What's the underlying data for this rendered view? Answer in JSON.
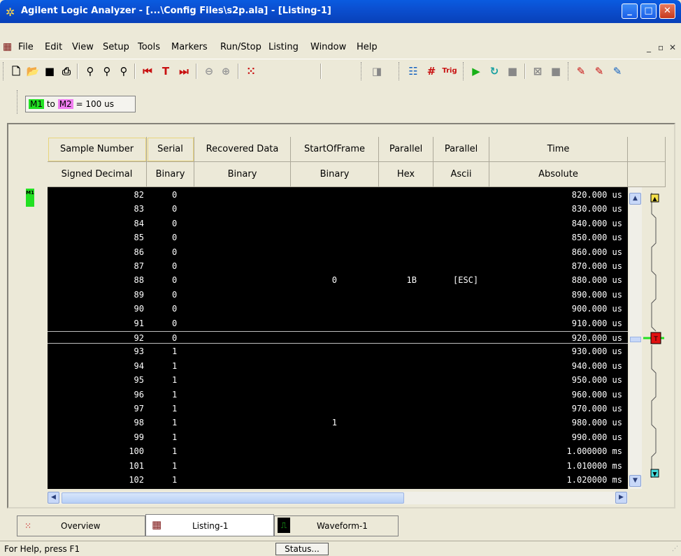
{
  "window": {
    "title": "Agilent Logic Analyzer - [...\\Config Files\\s2p.ala] - [Listing-1]"
  },
  "menu": [
    "File",
    "Edit",
    "View",
    "Setup",
    "Tools",
    "Markers",
    "Run/Stop",
    "Listing",
    "Window",
    "Help"
  ],
  "markers": {
    "m1": "M1",
    "to": "to",
    "m2": "M2",
    "interval": "= 100 us"
  },
  "columns": [
    {
      "name": "Sample Number",
      "format": "Signed Decimal"
    },
    {
      "name": "Serial",
      "format": "Binary"
    },
    {
      "name": "Recovered Data",
      "format": "Binary"
    },
    {
      "name": "StartOfFrame",
      "format": "Binary"
    },
    {
      "name": "Parallel",
      "format": "Hex"
    },
    {
      "name": "Parallel",
      "format": "Ascii"
    },
    {
      "name": "Time",
      "format": "Absolute"
    }
  ],
  "rows": [
    {
      "sample": "82",
      "serial": "0",
      "rec": "",
      "par": "",
      "asc": "",
      "time": "820.000 us"
    },
    {
      "sample": "83",
      "serial": "0",
      "rec": "",
      "par": "",
      "asc": "",
      "time": "830.000 us"
    },
    {
      "sample": "84",
      "serial": "0",
      "rec": "",
      "par": "",
      "asc": "",
      "time": "840.000 us"
    },
    {
      "sample": "85",
      "serial": "0",
      "rec": "",
      "par": "",
      "asc": "",
      "time": "850.000 us"
    },
    {
      "sample": "86",
      "serial": "0",
      "rec": "",
      "par": "",
      "asc": "",
      "time": "860.000 us"
    },
    {
      "sample": "87",
      "serial": "0",
      "rec": "",
      "par": "",
      "asc": "",
      "time": "870.000 us"
    },
    {
      "sample": "88",
      "serial": "0",
      "rec": "0",
      "par": "1B",
      "asc": "[ESC]",
      "time": "880.000 us"
    },
    {
      "sample": "89",
      "serial": "0",
      "rec": "",
      "par": "",
      "asc": "",
      "time": "890.000 us"
    },
    {
      "sample": "90",
      "serial": "0",
      "rec": "",
      "par": "",
      "asc": "",
      "time": "900.000 us"
    },
    {
      "sample": "91",
      "serial": "0",
      "rec": "",
      "par": "",
      "asc": "",
      "time": "910.000 us"
    },
    {
      "sample": "92",
      "serial": "0",
      "rec": "",
      "par": "",
      "asc": "",
      "time": "920.000 us"
    },
    {
      "sample": "93",
      "serial": "1",
      "rec": "",
      "par": "",
      "asc": "",
      "time": "930.000 us"
    },
    {
      "sample": "94",
      "serial": "1",
      "rec": "",
      "par": "",
      "asc": "",
      "time": "940.000 us"
    },
    {
      "sample": "95",
      "serial": "1",
      "rec": "",
      "par": "",
      "asc": "",
      "time": "950.000 us"
    },
    {
      "sample": "96",
      "serial": "1",
      "rec": "",
      "par": "",
      "asc": "",
      "time": "960.000 us"
    },
    {
      "sample": "97",
      "serial": "1",
      "rec": "",
      "par": "",
      "asc": "",
      "time": "970.000 us"
    },
    {
      "sample": "98",
      "serial": "1",
      "rec": "1",
      "par": "",
      "asc": "",
      "time": "980.000 us"
    },
    {
      "sample": "99",
      "serial": "1",
      "rec": "",
      "par": "",
      "asc": "",
      "time": "990.000 us"
    },
    {
      "sample": "100",
      "serial": "1",
      "rec": "",
      "par": "",
      "asc": "",
      "time": "1.000000 ms"
    },
    {
      "sample": "101",
      "serial": "1",
      "rec": "",
      "par": "",
      "asc": "",
      "time": "1.010000 ms"
    },
    {
      "sample": "102",
      "serial": "1",
      "rec": "",
      "par": "",
      "asc": "",
      "time": "1.020000 ms"
    }
  ],
  "selected_sample": "92",
  "tabs": [
    {
      "label": "Overview",
      "active": false
    },
    {
      "label": "Listing-1",
      "active": true
    },
    {
      "label": "Waveform-1",
      "active": false
    }
  ],
  "status": {
    "help": "For Help, press F1",
    "button": "Status..."
  },
  "colors": {
    "title_blue": "#0b4fd0",
    "data_bg": "#000000",
    "m1": "#22e022",
    "m2": "#f07ef0"
  }
}
